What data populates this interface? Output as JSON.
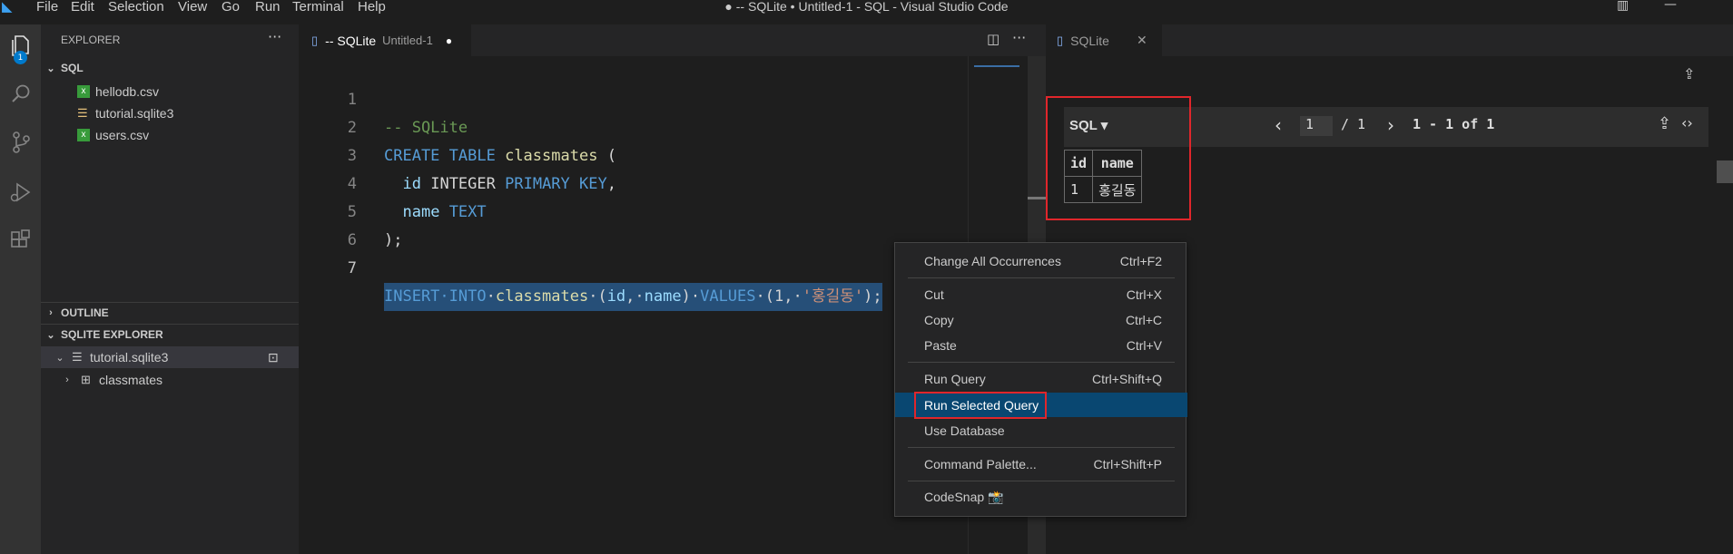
{
  "titlebar": {
    "menus": [
      "File",
      "Edit",
      "Selection",
      "View",
      "Go",
      "Run",
      "Terminal",
      "Help"
    ],
    "window_title": "● -- SQLite • Untitled-1 - SQL - Visual Studio Code"
  },
  "activity": {
    "badge": "1"
  },
  "sidebar": {
    "explorer_title": "EXPLORER",
    "folder": "SQL",
    "files": [
      "hellodb.csv",
      "tutorial.sqlite3",
      "users.csv"
    ],
    "outline": "OUTLINE",
    "sqlite_explorer": "SQLITE EXPLORER",
    "db": "tutorial.sqlite3",
    "table": "classmates"
  },
  "editor": {
    "tab_title": "-- SQLite",
    "tab_desc": "Untitled-1",
    "lines": [
      {
        "n": "1"
      },
      {
        "n": "2"
      },
      {
        "n": "3"
      },
      {
        "n": "4"
      },
      {
        "n": "5"
      },
      {
        "n": "6"
      },
      {
        "n": "7"
      }
    ]
  },
  "results": {
    "tab_title": "SQLite",
    "label": "SQL ▾",
    "page_input": "1",
    "page_total": "/ 1",
    "range": "1 - 1 of 1",
    "columns": [
      "id",
      "name"
    ],
    "rows": [
      [
        "1",
        "홍길동"
      ]
    ]
  },
  "context_menu": {
    "items": [
      {
        "label": "Change All Occurrences",
        "shortcut": "Ctrl+F2"
      },
      {
        "label": "Cut",
        "shortcut": "Ctrl+X"
      },
      {
        "label": "Copy",
        "shortcut": "Ctrl+C"
      },
      {
        "label": "Paste",
        "shortcut": "Ctrl+V"
      },
      {
        "label": "Run Query",
        "shortcut": "Ctrl+Shift+Q"
      },
      {
        "label": "Run Selected Query",
        "shortcut": ""
      },
      {
        "label": "Use Database",
        "shortcut": ""
      },
      {
        "label": "Command Palette...",
        "shortcut": "Ctrl+Shift+P"
      },
      {
        "label": "CodeSnap 📸",
        "shortcut": ""
      }
    ]
  },
  "colors": {
    "accent": "#007acc",
    "selection": "#094771",
    "highlight_border": "#e0262b"
  }
}
